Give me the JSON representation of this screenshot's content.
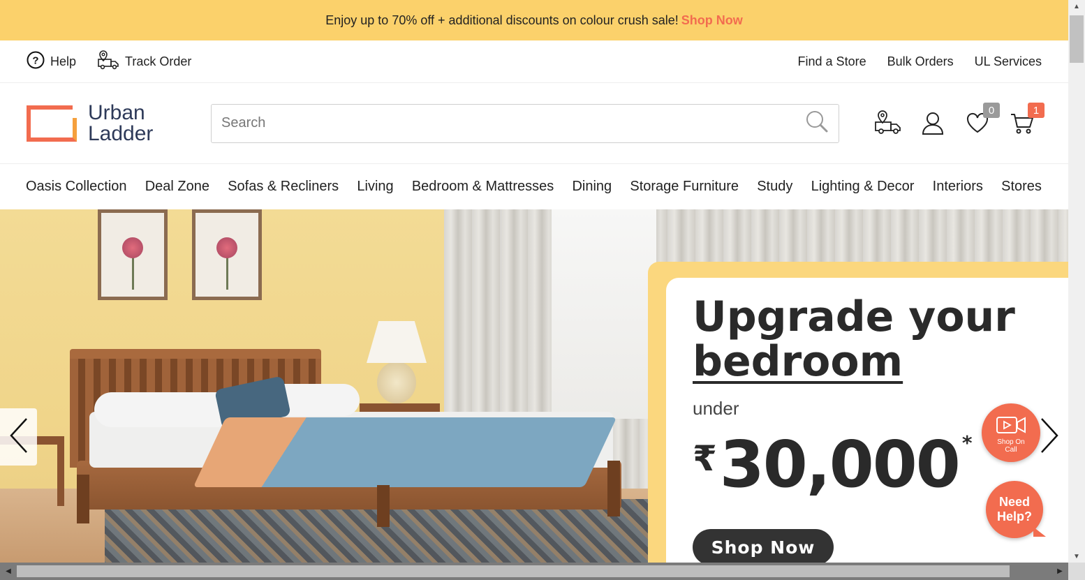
{
  "promo_bar": {
    "text": "Enjoy up to 70% off + additional discounts on colour crush sale!",
    "link": "Shop Now"
  },
  "utility": {
    "help": "Help",
    "track_order": "Track Order",
    "right_links": [
      "Find a Store",
      "Bulk Orders",
      "UL Services"
    ]
  },
  "header": {
    "logo_line1": "Urban",
    "logo_line2": "Ladder",
    "search_placeholder": "Search",
    "wishlist_count": "0",
    "cart_count": "1"
  },
  "categories": [
    "Oasis Collection",
    "Deal Zone",
    "Sofas & Recliners",
    "Living",
    "Bedroom & Mattresses",
    "Dining",
    "Storage Furniture",
    "Study",
    "Lighting & Decor",
    "Interiors",
    "Stores"
  ],
  "hero": {
    "headline_line1": "Upgrade your",
    "headline_line2": "bedroom",
    "under": "under",
    "currency": "₹",
    "price": "30,000",
    "asterisk": "*",
    "button": "Shop Now"
  },
  "floating": {
    "shop_on_call_1": "Shop On",
    "shop_on_call_2": "Call",
    "need_help_1": "Need",
    "need_help_2": "Help?"
  },
  "colors": {
    "promo_bg": "#fbd16b",
    "accent": "#f26c4f",
    "text": "#222222"
  }
}
